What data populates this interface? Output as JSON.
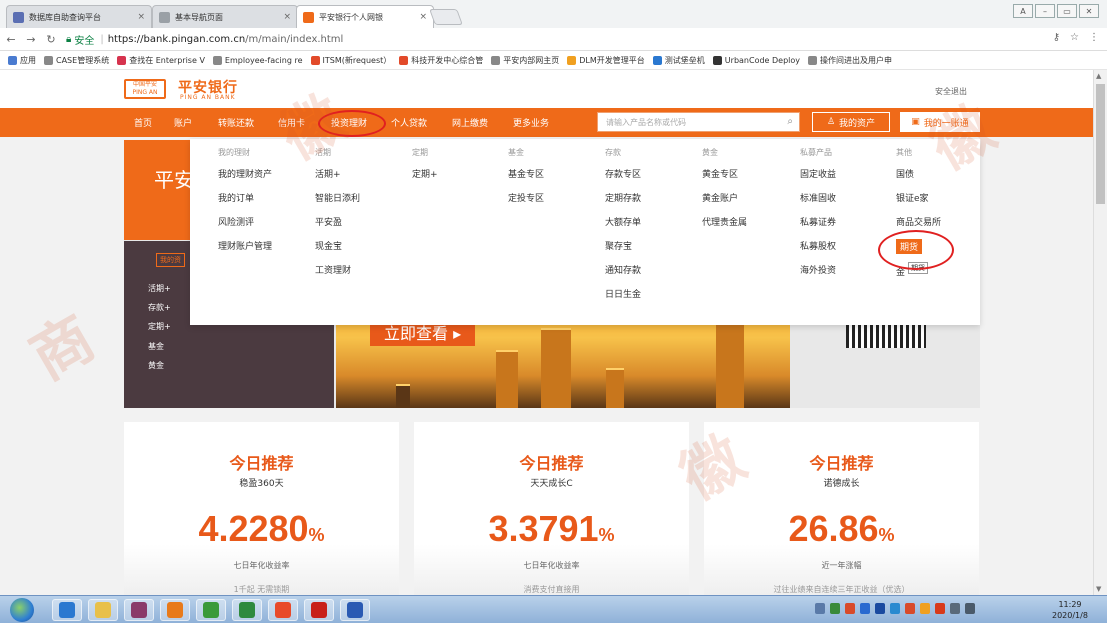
{
  "browser": {
    "tabs": [
      {
        "title": "数据库自助查询平台",
        "color": "#5b6fb3"
      },
      {
        "title": "基本导航页面",
        "color": "#9aa0a6"
      },
      {
        "title": "平安银行个人网银",
        "color": "#ef6a19"
      }
    ],
    "url": {
      "secure_label": "安全",
      "host": "https://bank.pingan.com.cn",
      "path": "/m/main/index.html"
    },
    "bookmarks": [
      {
        "label": "应用",
        "color": "#4a7bd0"
      },
      {
        "label": "CASE管理系统",
        "color": "#888888"
      },
      {
        "label": "查找在 Enterprise V",
        "color": "#d6334e"
      },
      {
        "label": "Employee-facing re",
        "color": "#888888"
      },
      {
        "label": "ITSM(新request）",
        "color": "#e24a2a"
      },
      {
        "label": "科技开发中心综合管",
        "color": "#e24a2a"
      },
      {
        "label": "平安内部网主页",
        "color": "#888888"
      },
      {
        "label": "DLM开发管理平台",
        "color": "#f0a020"
      },
      {
        "label": "测试堡垒机",
        "color": "#2a78d0"
      },
      {
        "label": "UrbanCode Deploy",
        "color": "#333333"
      },
      {
        "label": "操作间进出及用户申",
        "color": "#888888"
      }
    ]
  },
  "site": {
    "logo_box": [
      "中国平安",
      "PING AN"
    ],
    "logo_cn": "平安银行",
    "logo_en": "PING AN BANK",
    "logout": "安全退出",
    "nav": [
      "首页",
      "账户",
      "转账还款",
      "信用卡",
      "投资理财",
      "个人贷款",
      "网上缴费",
      "更多业务"
    ],
    "search_placeholder": "请输入产品名称或代码",
    "assets_btn": "我的资产",
    "account_btn": "我的一账通",
    "accent": "#ef6a19"
  },
  "dropdown": {
    "columns": [
      {
        "header": "我的理财",
        "items": [
          "我的理财资产",
          "我的订单",
          "风险测评",
          "理财账户管理"
        ]
      },
      {
        "header": "活期",
        "items": [
          "活期+",
          "智能日添利",
          "平安盈",
          "现金宝",
          "工资理财"
        ]
      },
      {
        "header": "定期",
        "items": [
          "定期+"
        ]
      },
      {
        "header": "基金",
        "items": [
          "基金专区",
          "定投专区"
        ]
      },
      {
        "header": "存款",
        "items": [
          "存款专区",
          "定期存款",
          "大额存单",
          "聚存宝",
          "通知存款",
          "日日生金"
        ]
      },
      {
        "header": "黄金",
        "items": [
          "黄金专区",
          "黄金账户",
          "代理贵金属"
        ]
      },
      {
        "header": "私募产品",
        "items": [
          "固定收益",
          "标准固收",
          "私募证券",
          "私募股权",
          "海外投资"
        ]
      },
      {
        "header": "其他",
        "items": [
          "国债",
          "银证e家",
          "商品交易所",
          "期货",
          "金"
        ]
      }
    ],
    "tooltip": "期货"
  },
  "banner": {
    "title": "平安",
    "side_tag": "我的资",
    "side_items": [
      "活期+",
      "存款+",
      "定期+",
      "基金",
      "黄金"
    ],
    "cta": "立即查看"
  },
  "cards": [
    {
      "title": "今日推荐",
      "name": "稳盈360天",
      "rate": "4.2280",
      "unit": "%",
      "label": "七日年化收益率",
      "extra": "1千起 无需锁期"
    },
    {
      "title": "今日推荐",
      "name": "天天成长C",
      "rate": "3.3791",
      "unit": "%",
      "label": "七日年化收益率",
      "extra": "消费支付直接用"
    },
    {
      "title": "今日推荐",
      "name": "诺德成长",
      "rate": "26.86",
      "unit": "%",
      "label": "近一年涨幅",
      "extra": "过往业绩来自连续三年正收益（优选）"
    }
  ],
  "taskbar": {
    "apps": [
      {
        "name": "ie",
        "color": "#2a78d0"
      },
      {
        "name": "explorer",
        "color": "#e8c04a"
      },
      {
        "name": "winrar",
        "color": "#8a3a6a"
      },
      {
        "name": "outlook",
        "color": "#e87a1a"
      },
      {
        "name": "chrome",
        "color": "#3a9a3a"
      },
      {
        "name": "excel",
        "color": "#2e8a3e"
      },
      {
        "name": "kuaiya",
        "color": "#e84a2a"
      },
      {
        "name": "acrobat",
        "color": "#c8201a"
      },
      {
        "name": "word",
        "color": "#2a5ab3"
      }
    ],
    "time": "11:29",
    "date": "2020/1/8"
  }
}
